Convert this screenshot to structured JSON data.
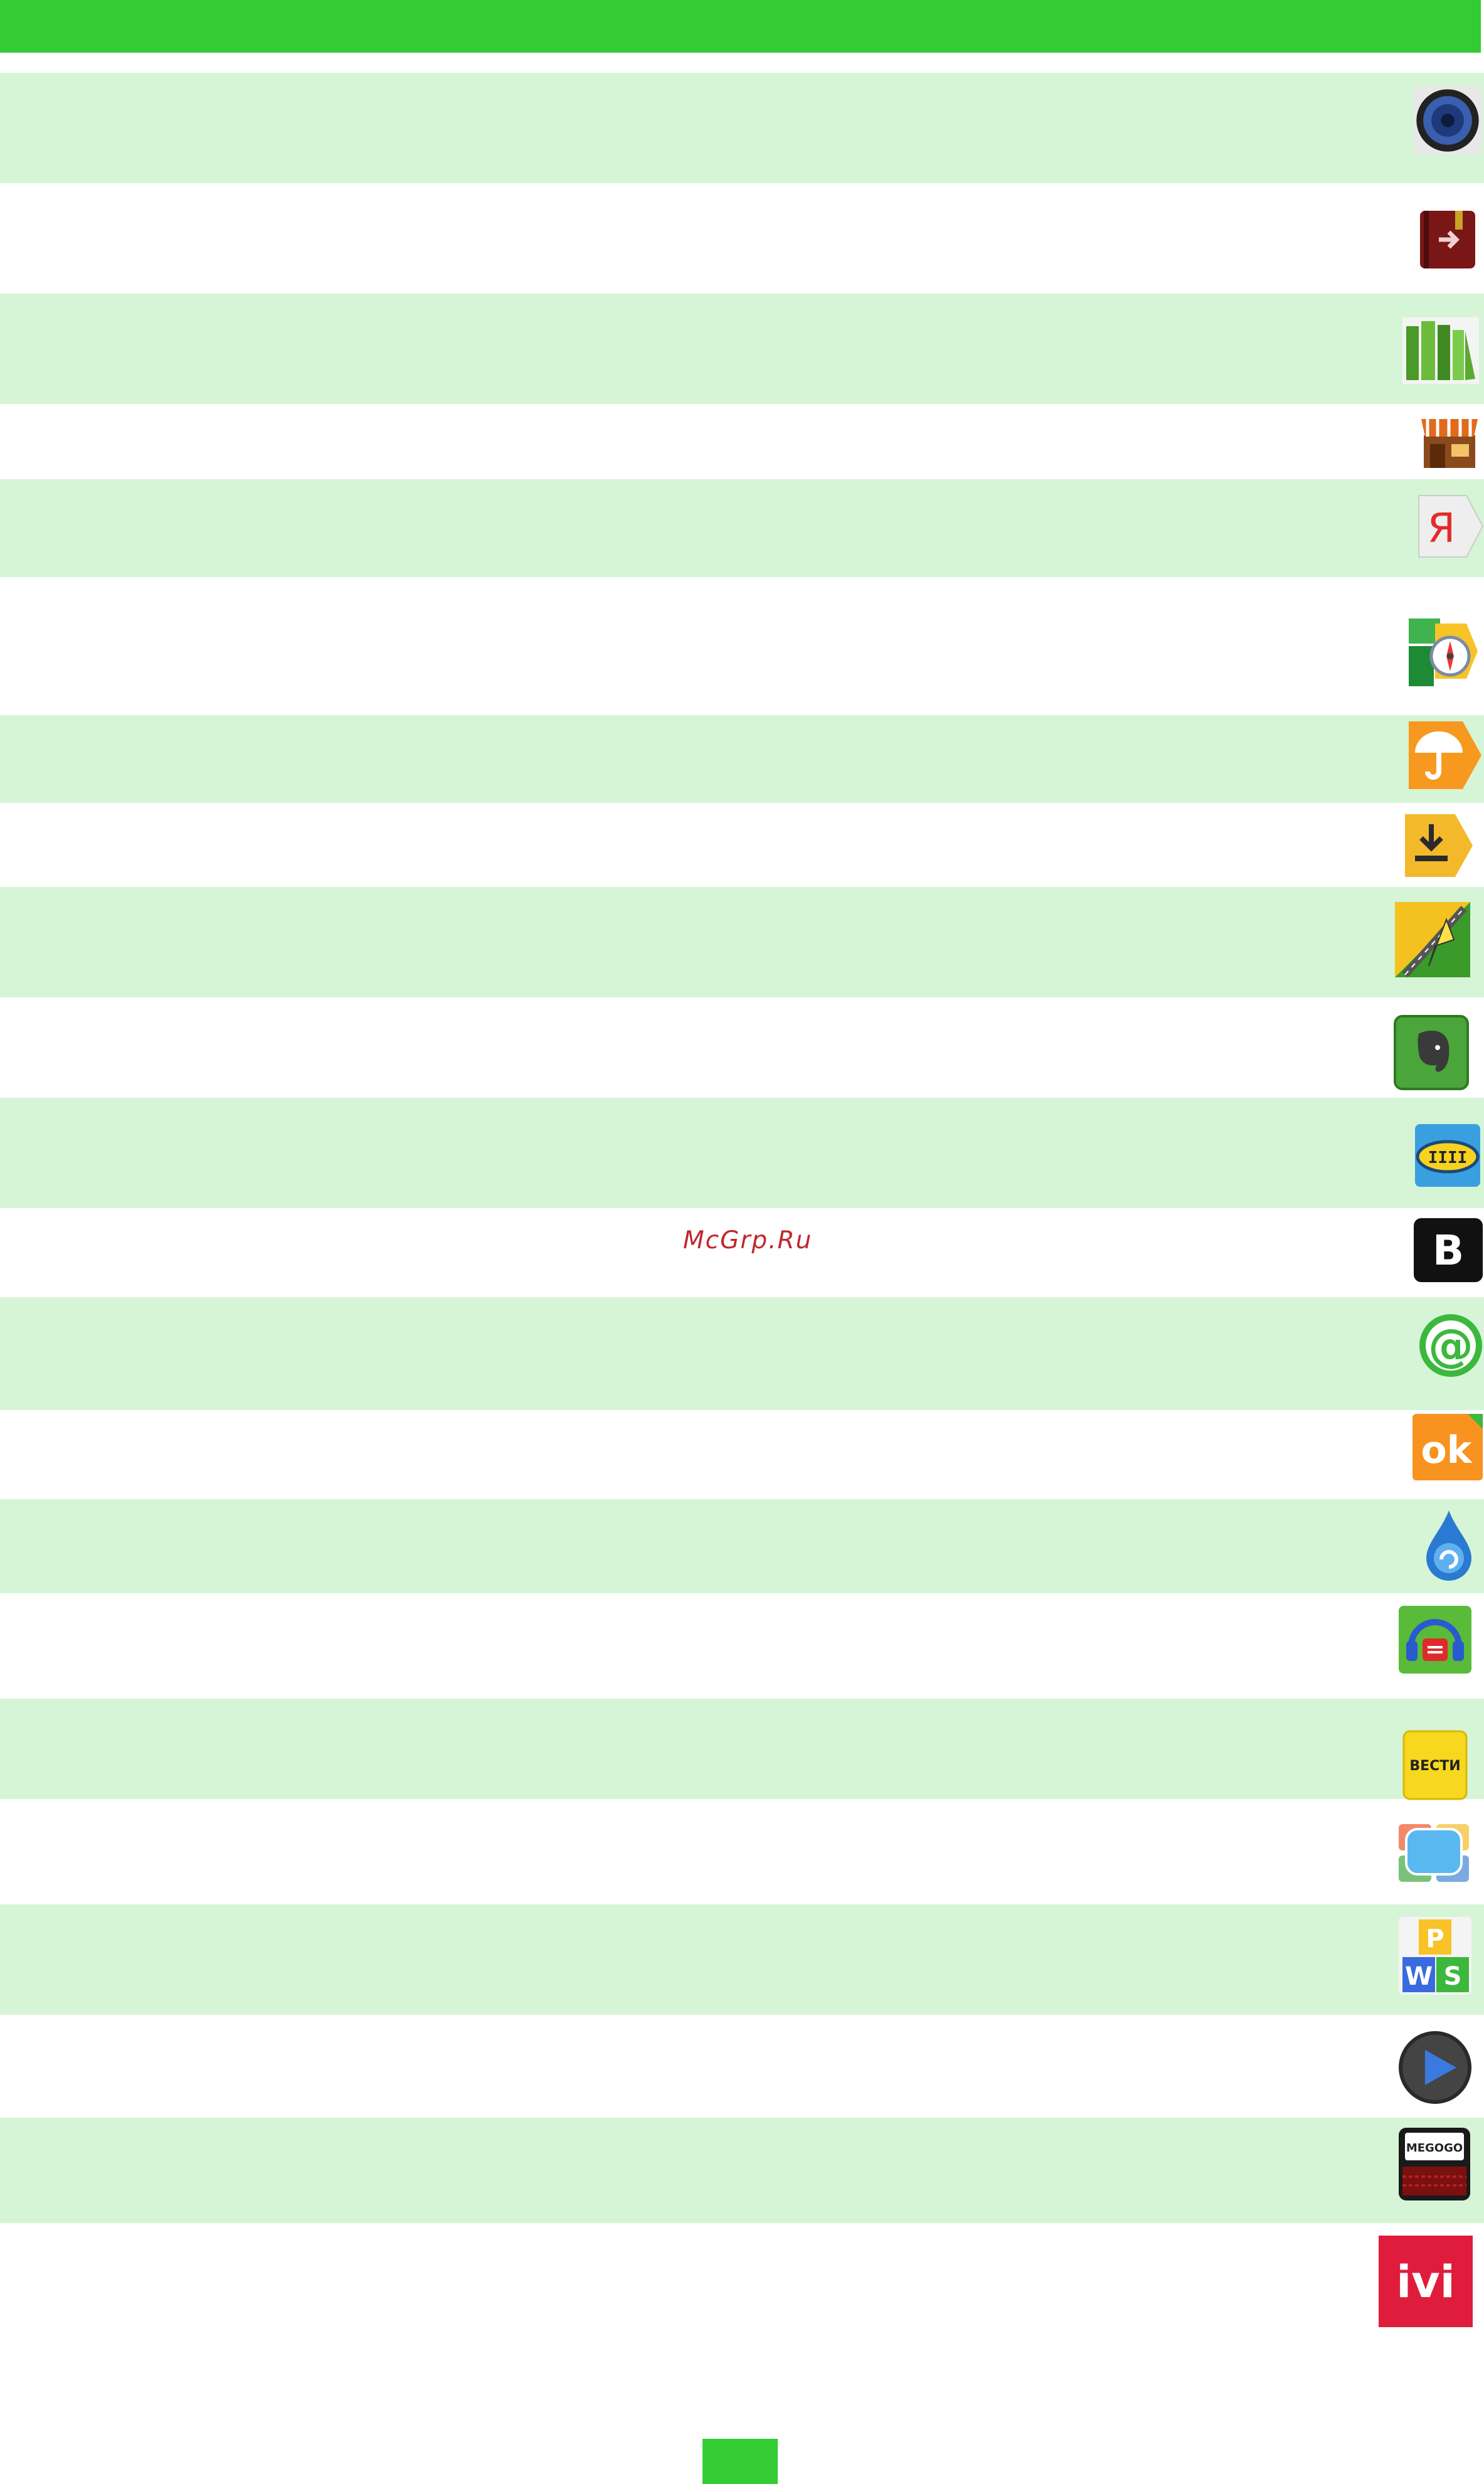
{
  "watermark": "McGrp.Ru",
  "colors": {
    "header": "#33cc33",
    "row_shade": "#d6f5d6",
    "watermark": "#c0282d"
  },
  "rows": [
    {
      "icon": "speaker-icon"
    },
    {
      "icon": "book-reader-icon"
    },
    {
      "icon": "bookshelf-icon"
    },
    {
      "icon": "shop-icon"
    },
    {
      "icon": "yandex-icon",
      "icon_text": "Я"
    },
    {
      "icon": "compass-maps-icon"
    },
    {
      "icon": "umbrella-weather-icon"
    },
    {
      "icon": "download-icon"
    },
    {
      "icon": "navigator-icon"
    },
    {
      "icon": "evernote-elephant-icon"
    },
    {
      "icon": "taxi-icon",
      "icon_text": "IIII"
    },
    {
      "icon": "vk-icon",
      "icon_text": "B"
    },
    {
      "icon": "mail-agent-icon",
      "icon_text": "@"
    },
    {
      "icon": "odnoklassniki-icon",
      "icon_text": "ok"
    },
    {
      "icon": "drop-sync-icon"
    },
    {
      "icon": "radio-headphones-icon"
    },
    {
      "icon": "vesti-icon",
      "icon_text": "ВЕСТИ"
    },
    {
      "icon": "tv-screen-icon"
    },
    {
      "icon": "wps-office-icon",
      "icon_text": "PWS"
    },
    {
      "icon": "play-icon"
    },
    {
      "icon": "megogo-icon",
      "icon_text": "MEGOGO"
    },
    {
      "icon": "ivi-icon",
      "icon_text": "ivi"
    }
  ]
}
